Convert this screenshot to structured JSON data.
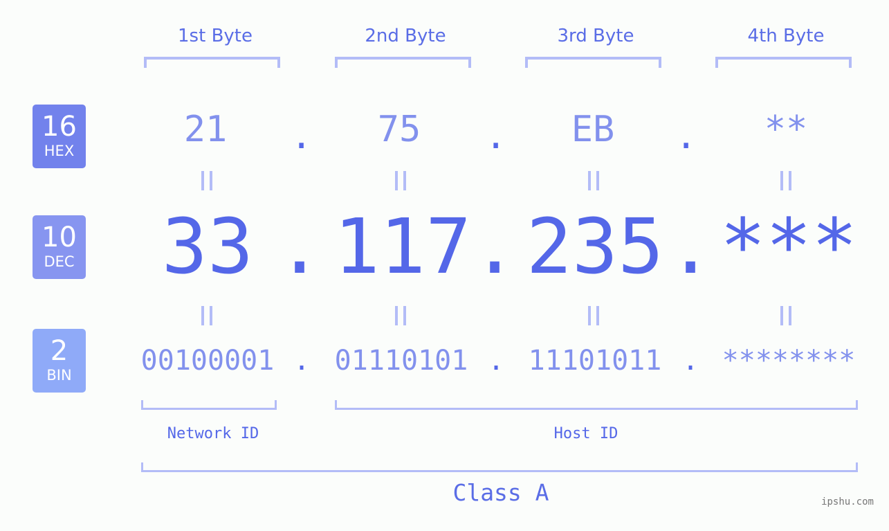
{
  "colors": {
    "hex_badge": "#7282ec",
    "dec_badge": "#8795f0",
    "bin_badge": "#8faaf8",
    "accent": "#5467e8",
    "light_value": "#8291ed",
    "bracket": "#b3bcf7"
  },
  "badges": [
    {
      "base": "16",
      "label": "HEX"
    },
    {
      "base": "10",
      "label": "DEC"
    },
    {
      "base": "2",
      "label": "BIN"
    }
  ],
  "byte_headers": [
    "1st Byte",
    "2nd Byte",
    "3rd Byte",
    "4th Byte"
  ],
  "separator": ".",
  "hex_values": [
    "21",
    "75",
    "EB",
    "**"
  ],
  "dec_values": [
    "33",
    "117",
    "235",
    "***"
  ],
  "bin_values": [
    "00100001",
    "01110101",
    "11101011",
    "********"
  ],
  "network_id_label": "Network ID",
  "host_id_label": "Host ID",
  "class_label": "Class A",
  "watermark": "ipshu.com"
}
